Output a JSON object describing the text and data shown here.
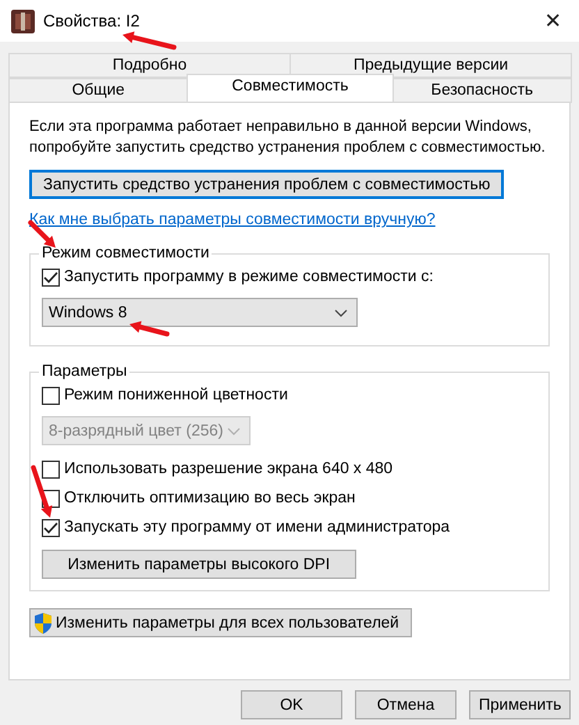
{
  "window": {
    "title": "Свойства: I2",
    "close": "✕"
  },
  "tab_rows": [
    [
      {
        "label": "Подробно",
        "selected": false
      },
      {
        "label": "Предыдущие версии",
        "selected": false
      }
    ],
    [
      {
        "label": "Общие",
        "selected": false
      },
      {
        "label": "Совместимость",
        "selected": true
      },
      {
        "label": "Безопасность",
        "selected": false
      }
    ]
  ],
  "description": "Если эта программа работает неправильно в данной версии Windows, попробуйте запустить средство устранения проблем с совместимостью.",
  "troubleshoot_button": "Запустить средство устранения проблем с совместимостью",
  "help_link": "Как мне выбрать параметры совместимости вручную?",
  "compat_group": {
    "title": "Режим совместимости",
    "checkbox": {
      "label": "Запустить программу в режиме совместимости с:",
      "checked": true
    },
    "select": {
      "value": "Windows 8",
      "disabled": false
    }
  },
  "params_group": {
    "title": "Параметры",
    "items": [
      {
        "kind": "checkbox",
        "label": "Режим пониженной цветности",
        "checked": false
      },
      {
        "kind": "select",
        "value": "8-разрядный цвет (256)",
        "disabled": true
      },
      {
        "kind": "checkbox",
        "label": "Использовать разрешение экрана 640 x 480",
        "checked": false
      },
      {
        "kind": "checkbox",
        "label": "Отключить оптимизацию во весь экран",
        "checked": false
      },
      {
        "kind": "checkbox",
        "label": "Запускать эту программу от имени администратора",
        "checked": true
      },
      {
        "kind": "button",
        "label": "Изменить параметры высокого DPI"
      }
    ]
  },
  "all_users_button": "Изменить параметры для всех пользователей",
  "buttons": [
    "OK",
    "Отмена",
    "Применить"
  ]
}
